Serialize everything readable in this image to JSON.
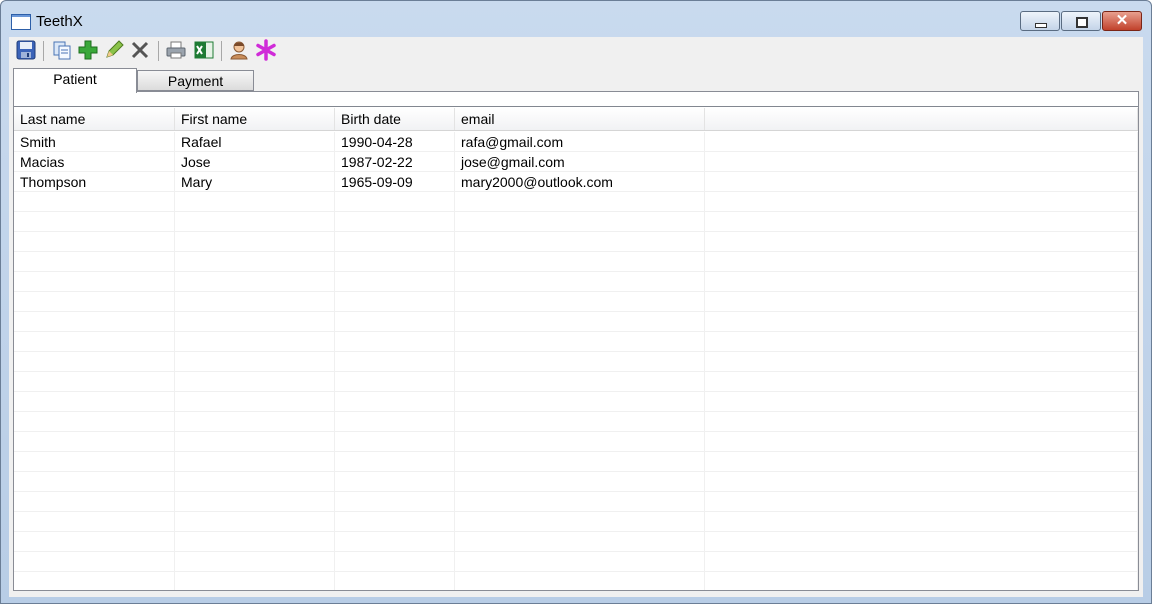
{
  "window": {
    "title": "TeethX",
    "controls": {
      "minimize": "minimize",
      "maximize": "restore",
      "close": "close",
      "close_glyph": "✕"
    }
  },
  "toolbar": {
    "items": [
      {
        "icon": "save-icon"
      },
      {
        "icon": "copy-icon"
      },
      {
        "icon": "add-icon"
      },
      {
        "icon": "edit-icon"
      },
      {
        "icon": "delete-icon"
      },
      {
        "icon": "print-icon"
      },
      {
        "icon": "excel-icon"
      },
      {
        "icon": "user-icon"
      },
      {
        "icon": "asterisk-icon"
      }
    ]
  },
  "tabs": [
    {
      "label": "Patient",
      "active": true
    },
    {
      "label": "Payment",
      "active": false
    }
  ],
  "grid": {
    "columns": [
      "Last name",
      "First name",
      "Birth date",
      "email",
      ""
    ],
    "rows": [
      [
        "Smith",
        "Rafael",
        "1990-04-28",
        "rafa@gmail.com",
        ""
      ],
      [
        "Macias",
        "Jose",
        "1987-02-22",
        "jose@gmail.com",
        ""
      ],
      [
        "Thompson",
        "Mary",
        "1965-09-09",
        "mary2000@outlook.com",
        ""
      ]
    ]
  },
  "colors": {
    "titlebar": "#c9daee",
    "close_button": "#c1412b",
    "grid_line": "#f0f0f0"
  }
}
